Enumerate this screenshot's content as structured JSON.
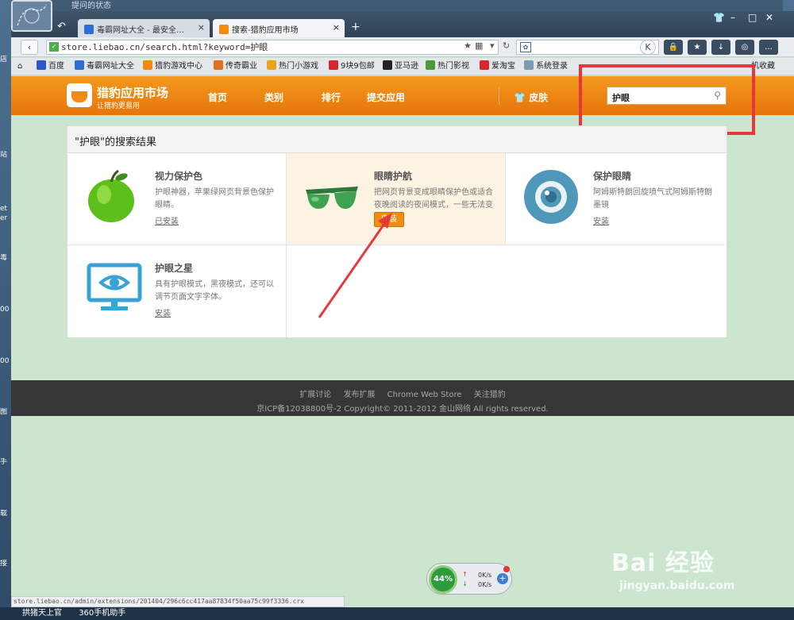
{
  "desktop": {
    "top_label": "提问的状态",
    "left_fragments": [
      "店",
      "站",
      "et",
      "er",
      "毒",
      "003",
      "003",
      "图",
      "手",
      "载",
      "接"
    ],
    "taskbar": [
      "拱猪天上官",
      "360手机助手"
    ]
  },
  "browser": {
    "tabs": [
      {
        "title": "毒霸网址大全 - 最安全…",
        "fav_color": "#2f6fd0"
      },
      {
        "title": "搜索-猎豹应用市场",
        "fav_color": "#f28a15"
      }
    ],
    "new_tab": "+",
    "url": "store.liebao.cn/search.html?keyword=护眼",
    "search_engine": "paw-icon",
    "status_url": "store.liebao.cn/admin/extensions/201404/296c6cc417aa87834f50aa75c99f3336.crx",
    "bookmarks": [
      {
        "label": "百度",
        "color": "#2f56c9"
      },
      {
        "label": "毒霸网址大全",
        "color": "#2f6fd0"
      },
      {
        "label": "猎豹游戏中心",
        "color": "#f28a15"
      },
      {
        "label": "传奇霸业",
        "color": "#e07020"
      },
      {
        "label": "热门小游戏",
        "color": "#e8a41a"
      },
      {
        "label": "9块9包邮",
        "color": "#d8262c"
      },
      {
        "label": "亚马逊",
        "color": "#222222"
      },
      {
        "label": "热门影视",
        "color": "#4a9a3c"
      },
      {
        "label": "爱淘宝",
        "color": "#d8262c"
      },
      {
        "label": "系统登录",
        "color": "#7a9bb0"
      }
    ],
    "bookmarks_right": "机收藏"
  },
  "site": {
    "logo_title": "猎豹应用市场",
    "logo_sub": "让猎豹更易用",
    "nav": [
      "首页",
      "类别",
      "排行",
      "提交应用"
    ],
    "skin": "皮肤",
    "search_value": "护眼",
    "results_heading": "\"护眼\"的搜索结果",
    "results": [
      {
        "name": "视力保护色",
        "desc": "护眼神器，苹果绿网页背景色保护眼睛。",
        "action": "已安装",
        "icon": "apple-icon"
      },
      {
        "name": "眼睛护航",
        "desc": "把网页背景变成眼睛保护色或适合夜晚阅读的夜间模式，一些无法变",
        "action": "安装",
        "icon": "sunglasses-icon"
      },
      {
        "name": "保护眼睛",
        "desc": "阿姆斯特朗回旋喷气式阿姆斯特朗墨镜",
        "action": "安装",
        "icon": "eye-circle-icon"
      },
      {
        "name": "护眼之星",
        "desc": "具有护眼模式，黑夜模式，还可以调节页面文字字体。",
        "action": "安装",
        "icon": "monitor-eye-icon"
      }
    ],
    "footer_links": [
      "扩展讨论",
      "发布扩展",
      "Chrome Web Store",
      "关注猎豹"
    ],
    "footer_copy": "京ICP备12038800号-2 Copyright© 2011-2012 金山网络 All rights reserved."
  },
  "speed_widget": {
    "percent": "44%",
    "up": "0K/s",
    "down": "0K/s"
  },
  "watermark": {
    "brand": "Bai 经验",
    "domain": "jingyan.baidu.com"
  },
  "colors": {
    "orange": "#ef8410",
    "page_bg": "#cbe5ce",
    "highlight": "#e4383a"
  }
}
